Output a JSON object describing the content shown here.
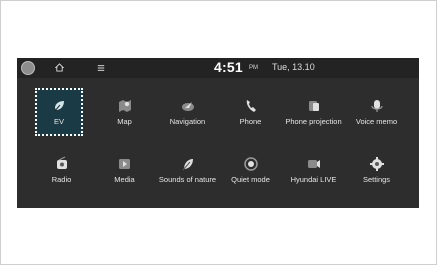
{
  "status": {
    "time": "4:51",
    "ampm": "PM",
    "date": "Tue, 13.10"
  },
  "apps": [
    {
      "label": "EV",
      "icon": "ev-icon"
    },
    {
      "label": "Map",
      "icon": "map-icon"
    },
    {
      "label": "Navigation",
      "icon": "navigation-icon"
    },
    {
      "label": "Phone",
      "icon": "phone-icon"
    },
    {
      "label": "Phone projection",
      "icon": "phone-projection-icon"
    },
    {
      "label": "Voice memo",
      "icon": "voice-memo-icon"
    },
    {
      "label": "Radio",
      "icon": "radio-icon"
    },
    {
      "label": "Media",
      "icon": "media-icon"
    },
    {
      "label": "Sounds of nature",
      "icon": "sounds-of-nature-icon"
    },
    {
      "label": "Quiet mode",
      "icon": "quiet-mode-icon"
    },
    {
      "label": "Hyundai LIVE",
      "icon": "hyundai-live-icon"
    },
    {
      "label": "Settings",
      "icon": "settings-icon"
    }
  ],
  "selected_app": "EV",
  "colors": {
    "screen_bg": "#2d2d2d",
    "selected_bg": "#1a3b45",
    "text": "#e6e6e6"
  }
}
